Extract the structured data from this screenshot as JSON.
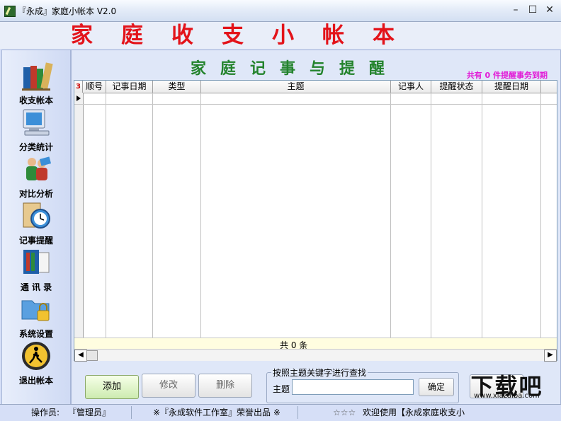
{
  "window": {
    "title": "『永成』家庭小帐本 V2.0",
    "min": "–",
    "max": "☐",
    "close": "✕"
  },
  "banner": {
    "title": "家庭收支小帐本"
  },
  "sidebar": {
    "items": [
      {
        "label": "收支帐本",
        "icon": "books-icon"
      },
      {
        "label": "分类统计",
        "icon": "computer-icon"
      },
      {
        "label": "对比分析",
        "icon": "people-icon"
      },
      {
        "label": "记事提醒",
        "icon": "clock-icon"
      },
      {
        "label": "通 讯 录",
        "icon": "address-book-icon"
      },
      {
        "label": "系统设置",
        "icon": "folder-lock-icon"
      },
      {
        "label": "退出帐本",
        "icon": "exit-icon"
      }
    ]
  },
  "main": {
    "heading": "家庭记事与提醒",
    "due_note": "共有 0 件提醒事务到期",
    "grid": {
      "corner_mark": "3",
      "columns": [
        "顺号",
        "记事日期",
        "类型",
        "主题",
        "记事人",
        "提醒状态",
        "提醒日期"
      ],
      "rows": [],
      "footer_count": "共 0 条"
    },
    "buttons": {
      "add": "添加",
      "edit": "修改",
      "delete": "删除"
    },
    "search": {
      "legend": "按照主题关键字进行查找",
      "label": "主题",
      "value": "",
      "confirm": "确定"
    }
  },
  "status": {
    "operator_label": "操作员:",
    "operator": "『管理员』",
    "credit": "※『永成软件工作室』荣誉出品 ※",
    "stars": "☆☆☆",
    "welcome": "欢迎使用【永成家庭收支小"
  },
  "watermark": {
    "big": "下载吧",
    "small": "www.xiazaiba.com"
  }
}
